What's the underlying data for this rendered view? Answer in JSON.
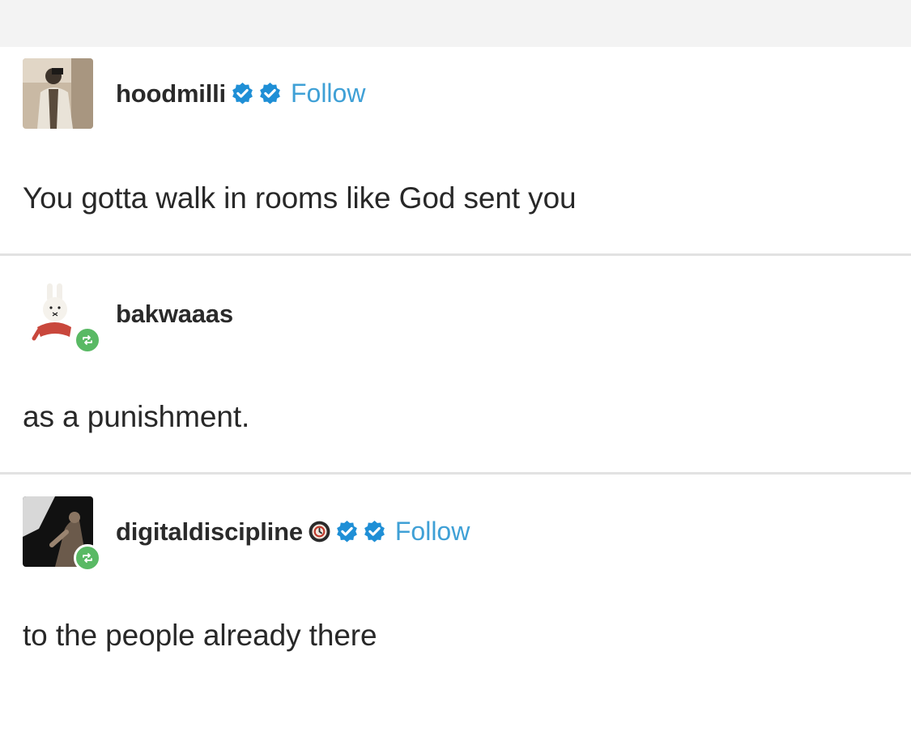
{
  "posts": [
    {
      "username": "hoodmilli",
      "follow_label": "Follow",
      "text": "You gotta walk in rooms like God sent you",
      "avatar_icon": "person-photo-avatar",
      "badges": [
        "verified-badge-icon",
        "verified-badge-icon"
      ]
    },
    {
      "username": "bakwaaas",
      "text": "as a punishment.",
      "avatar_icon": "bunny-avatar",
      "reblog_icon": "reblog-icon"
    },
    {
      "username": "digitaldiscipline",
      "follow_label": "Follow",
      "text": "to the people already there",
      "avatar_icon": "dark-photo-avatar",
      "badges": [
        "clock-badge-icon",
        "verified-badge-icon",
        "verified-badge-icon"
      ],
      "reblog_icon": "reblog-icon"
    }
  ],
  "colors": {
    "follow_link": "#3fa0d6",
    "verified_badge": "#1f8fd6",
    "reblog_badge": "#59b964",
    "divider": "#e2e2e2"
  }
}
